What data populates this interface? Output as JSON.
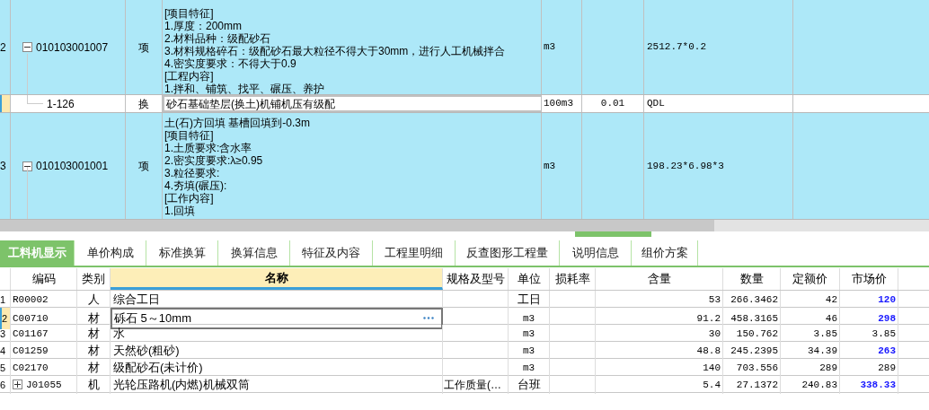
{
  "top_grid": {
    "rows": [
      {
        "kind": "item",
        "number": "2",
        "code": "010103001007",
        "expanded": true,
        "type": "项",
        "name_lines": [
          "[项目特征]",
          "1.厚度：200mm",
          "2.材料品种：级配砂石",
          "3.材料规格碎石：级配砂石最大粒径不得大于30mm，进行人工机械拌合",
          "4.密实度要求：不得大于0.9",
          "[工程内容]",
          "1.拌和、铺筑、找平、碾压、养护"
        ],
        "unit": "m3",
        "expression": "2512.7*0.2",
        "selected": false
      },
      {
        "kind": "sub",
        "code": "1-126",
        "type": "换",
        "name_lines": [
          "砂石基础垫层(换土)机铺机压有级配"
        ],
        "unit": "100m3",
        "column_6": "0.01",
        "expression": "QDL",
        "selected": true
      },
      {
        "kind": "item",
        "number": "3",
        "code": "010103001001",
        "expanded": true,
        "type": "项",
        "name_lines": [
          "土(石)方回填 基槽回填到-0.3m",
          "[项目特征]",
          "1.土质要求:含水率",
          "2.密实度要求:λ≥0.95",
          "3.粒径要求:",
          "4.夯填(碾压):",
          "[工作内容]",
          "1.回填"
        ],
        "unit": "m3",
        "expression": "198.23*6.98*3",
        "selected": false
      }
    ]
  },
  "tabs": [
    {
      "label": "工料机显示",
      "selected": true
    },
    {
      "label": "单价构成",
      "selected": false
    },
    {
      "label": "标准换算",
      "selected": false
    },
    {
      "label": "换算信息",
      "selected": false
    },
    {
      "label": "特征及内容",
      "selected": false
    },
    {
      "label": "工程里明细",
      "selected": false
    },
    {
      "label": "反查图形工程量",
      "selected": false
    },
    {
      "label": "说明信息",
      "selected": false
    },
    {
      "label": "组价方案",
      "selected": false
    }
  ],
  "resource_table": {
    "columns": [
      {
        "label": "编码",
        "selected": false
      },
      {
        "label": "类别",
        "selected": false
      },
      {
        "label": "名称",
        "selected": true
      },
      {
        "label": "规格及型号",
        "selected": false
      },
      {
        "label": "单位",
        "selected": false
      },
      {
        "label": "损耗率",
        "selected": false
      },
      {
        "label": "含量",
        "selected": false
      },
      {
        "label": "数量",
        "selected": false
      },
      {
        "label": "定额价",
        "selected": false
      },
      {
        "label": "市场价",
        "selected": false
      }
    ],
    "rows": [
      {
        "number": "1",
        "code": "R00002",
        "category": "人",
        "name": "综合工日",
        "unit": "工日",
        "content": "53",
        "quantity": "266.3462",
        "base_price": "42",
        "market_price": "120",
        "price_adjusted": true,
        "selected": false
      },
      {
        "number": "2",
        "code": "C00710",
        "category": "材",
        "name": "砾石 5～10mm",
        "unit": "m3",
        "content": "91.2",
        "quantity": "458.3165",
        "base_price": "46",
        "market_price": "298",
        "price_adjusted": true,
        "selected": true
      },
      {
        "number": "3",
        "code": "C01167",
        "category": "材",
        "name": "水",
        "unit": "m3",
        "content": "30",
        "quantity": "150.762",
        "base_price": "3.85",
        "market_price": "3.85",
        "price_adjusted": false,
        "selected": false
      },
      {
        "number": "4",
        "code": "C01259",
        "category": "材",
        "name": "天然砂(粗砂)",
        "unit": "m3",
        "content": "48.8",
        "quantity": "245.2395",
        "base_price": "34.39",
        "market_price": "263",
        "price_adjusted": true,
        "selected": false
      },
      {
        "number": "5",
        "code": "C02170",
        "category": "材",
        "name": "级配砂石(未计价)",
        "unit": "m3",
        "content": "140",
        "quantity": "703.556",
        "base_price": "289",
        "market_price": "289",
        "price_adjusted": false,
        "selected": false
      },
      {
        "number": "6",
        "code": "J01055",
        "expanded": false,
        "category": "机",
        "name": "光轮压路机(内燃)机械双筒",
        "spec": "工作质量(…",
        "unit": "台班",
        "content": "5.4",
        "quantity": "27.1372",
        "base_price": "240.83",
        "market_price": "338.33",
        "price_adjusted": true,
        "selected": false
      }
    ]
  }
}
